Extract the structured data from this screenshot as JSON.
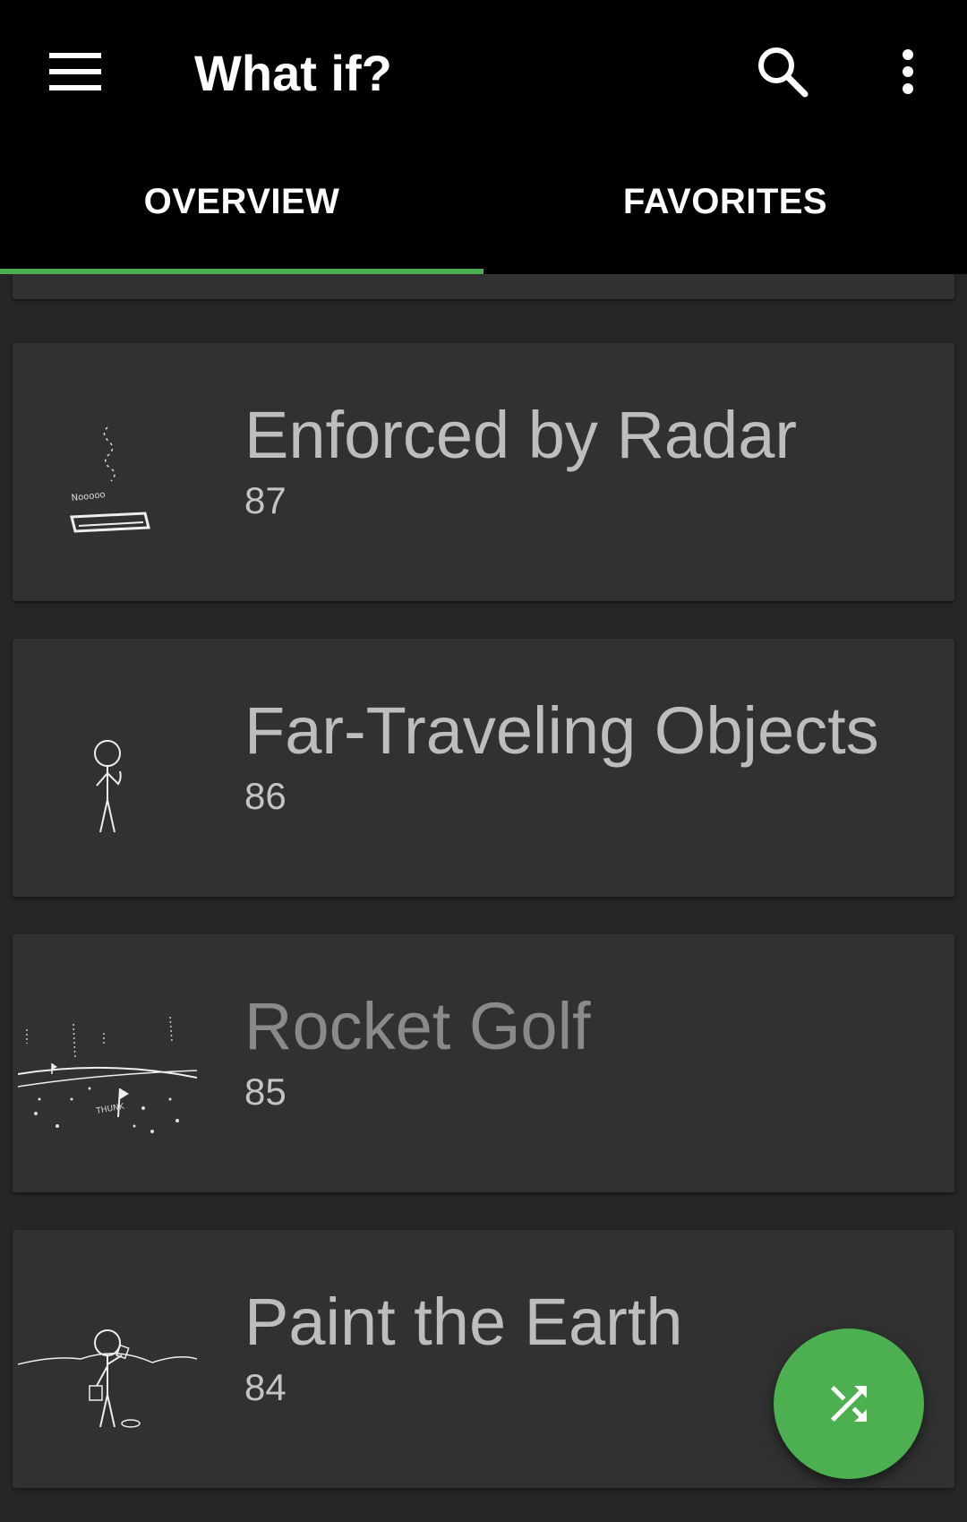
{
  "app_bar": {
    "title": "What if?",
    "menu_icon": "hamburger-menu-icon",
    "search_icon": "search-icon",
    "overflow_icon": "more-vert-icon"
  },
  "tabs": [
    {
      "label": "OVERVIEW",
      "selected": true
    },
    {
      "label": "FAVORITES",
      "selected": false
    }
  ],
  "articles": [
    {
      "title": "Enforced by Radar",
      "number": "87",
      "thumbnail": "tablet-sketch"
    },
    {
      "title": "Far-Traveling Objects",
      "number": "86",
      "thumbnail": "stick-figure-sketch"
    },
    {
      "title": "Rocket Golf",
      "number": "85",
      "thumbnail": "golf-field-sketch"
    },
    {
      "title": "Paint the Earth",
      "number": "84",
      "thumbnail": "painter-sketch"
    }
  ],
  "sketch_text": {
    "radar_caption": "Nooooo",
    "golf_caption": "THUNK"
  },
  "fab": {
    "icon": "shuffle-icon"
  },
  "colors": {
    "accent": "#4caf50",
    "background": "#262626",
    "card": "#313131",
    "toolbar": "#000000"
  }
}
